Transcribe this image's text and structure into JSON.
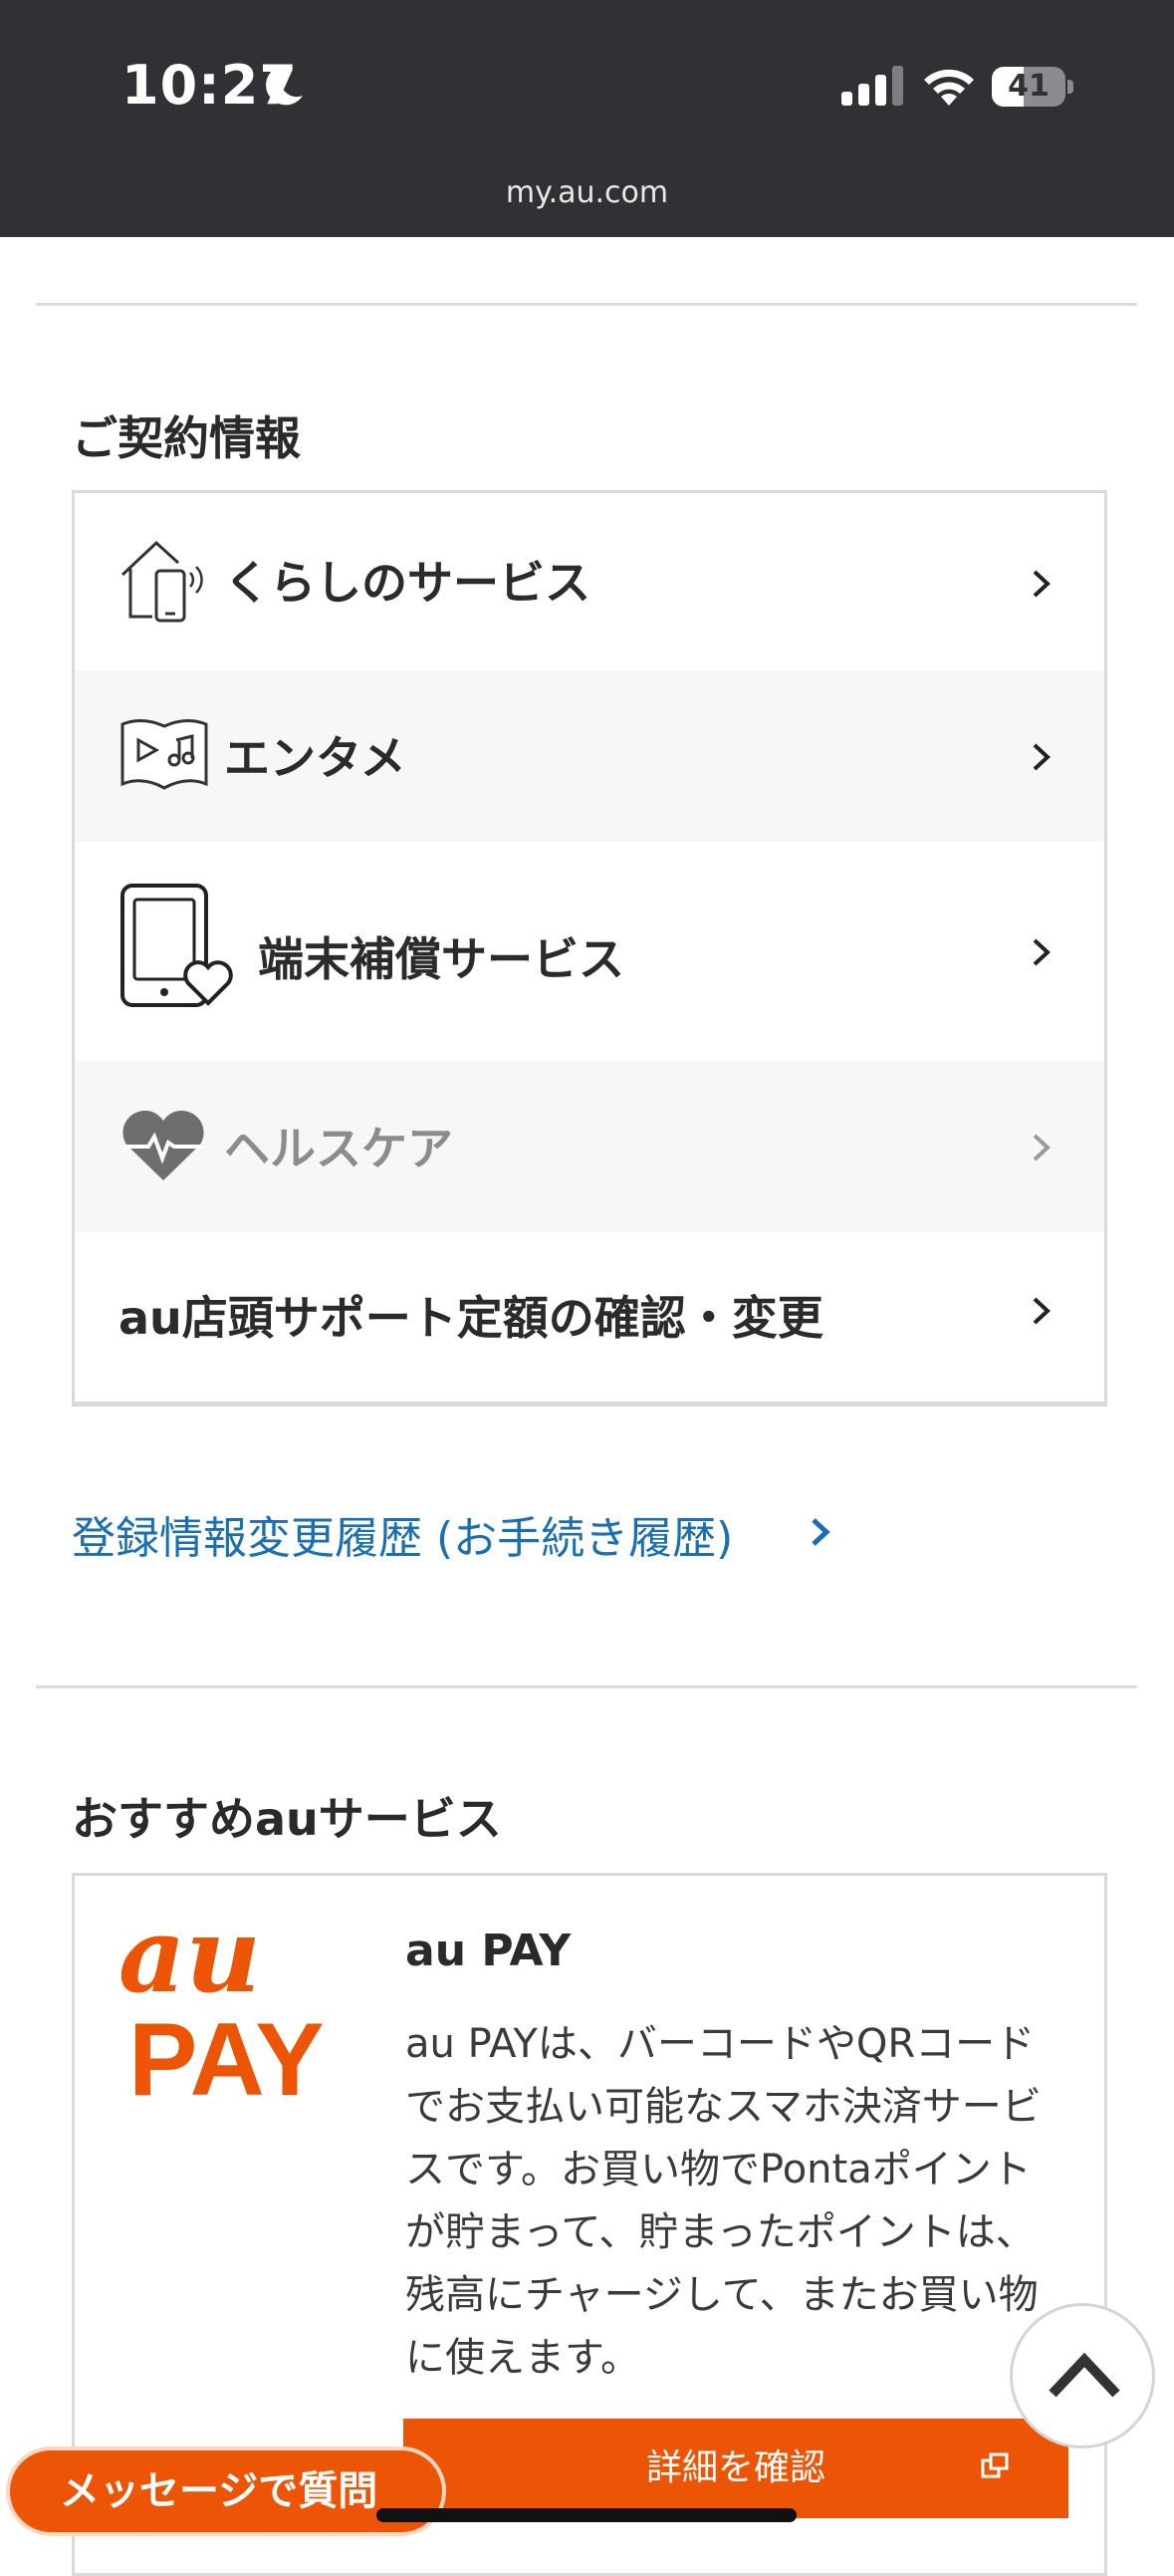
{
  "status_bar": {
    "time": "10:27",
    "battery": "41",
    "battery_level": 0.41,
    "url": "my.au.com"
  },
  "contract_section": {
    "title": "ご契約情報",
    "items": [
      {
        "label": "くらしのサービス",
        "icon": "home-smartphone-icon"
      },
      {
        "label": "エンタメ",
        "icon": "book-music-icon"
      },
      {
        "label": "端末補償サービス",
        "icon": "device-heart-icon"
      },
      {
        "label": "ヘルスケア",
        "icon": "heart-pulse-icon"
      },
      {
        "label": "au店頭サポート定額の確認・変更",
        "icon": ""
      }
    ],
    "history_link": "登録情報変更履歴 (お手続き履歴)"
  },
  "recommend_section": {
    "title": "おすすめauサービス",
    "service": {
      "logo_text_top": "au",
      "logo_text_bottom": "PAY",
      "title": "au PAY",
      "description": "au PAYは、バーコードやQRコードでお支払い可能なスマホ決済サービスです。お買い物でPontaポイントが貯まって、貯まったポイントは、残高にチャージして、またお買い物に使えます。",
      "button_label": "詳細を確認"
    }
  },
  "floating": {
    "message_button": "メッセージで質問"
  },
  "colors": {
    "accent": "#eb5505",
    "link": "#1a6fb3",
    "status_bar": "#2f3134"
  }
}
